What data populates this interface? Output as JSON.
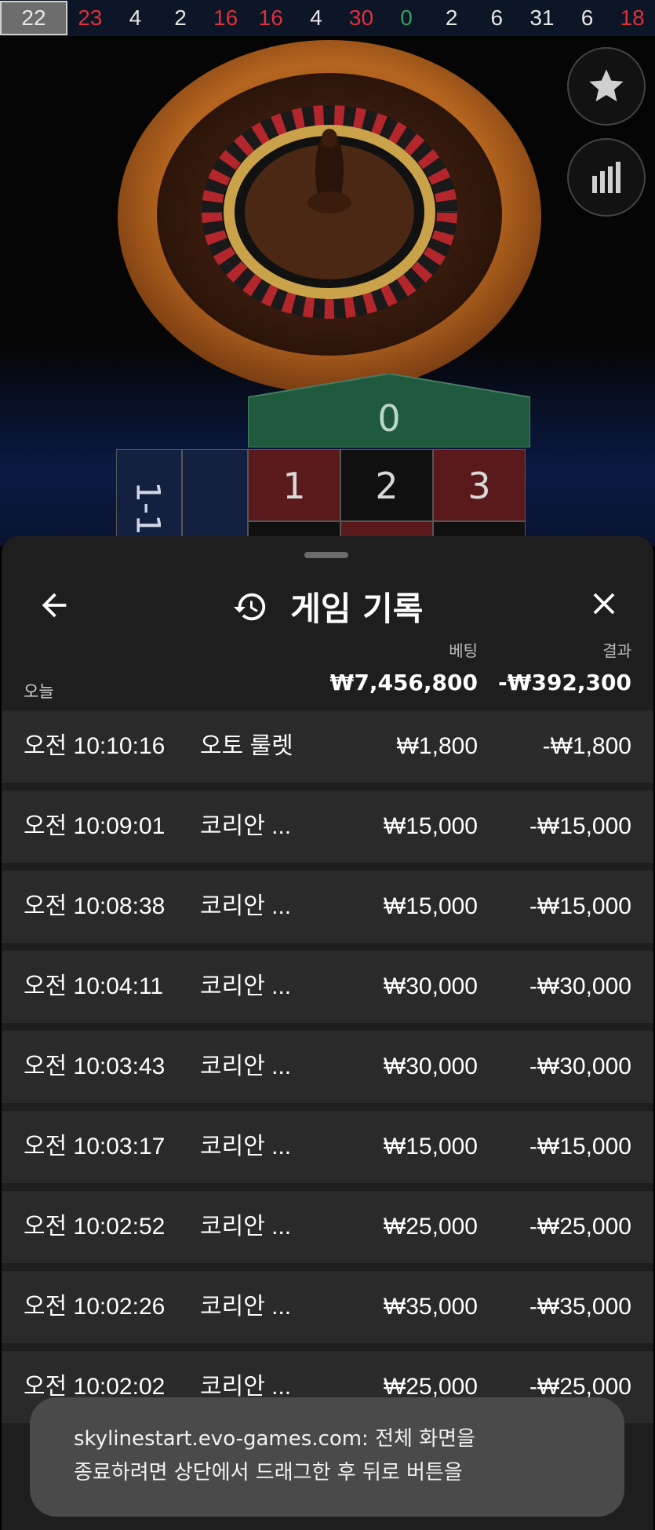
{
  "history_strip": [
    {
      "n": "22",
      "color": "current"
    },
    {
      "n": "23",
      "color": "red"
    },
    {
      "n": "4",
      "color": "black"
    },
    {
      "n": "2",
      "color": "black"
    },
    {
      "n": "16",
      "color": "red"
    },
    {
      "n": "16",
      "color": "red"
    },
    {
      "n": "4",
      "color": "black"
    },
    {
      "n": "30",
      "color": "red"
    },
    {
      "n": "0",
      "color": "green"
    },
    {
      "n": "2",
      "color": "black"
    },
    {
      "n": "6",
      "color": "black"
    },
    {
      "n": "31",
      "color": "black"
    },
    {
      "n": "6",
      "color": "black"
    },
    {
      "n": "18",
      "color": "red"
    }
  ],
  "table": {
    "zero": "0",
    "row1": [
      "1",
      "2",
      "3"
    ],
    "side_label": "1-1"
  },
  "sheet": {
    "title": "게임 기록",
    "col_bet": "베팅",
    "col_result": "결과",
    "today_label": "오늘",
    "total_bet": "₩7,456,800",
    "total_result": "-₩392,300",
    "rows": [
      {
        "time": "오전 10:10:16",
        "game": "오토 룰렛",
        "bet": "₩1,800",
        "result": "-₩1,800"
      },
      {
        "time": "오전 10:09:01",
        "game": "코리안 ...",
        "bet": "₩15,000",
        "result": "-₩15,000"
      },
      {
        "time": "오전 10:08:38",
        "game": "코리안 ...",
        "bet": "₩15,000",
        "result": "-₩15,000"
      },
      {
        "time": "오전 10:04:11",
        "game": "코리안 ...",
        "bet": "₩30,000",
        "result": "-₩30,000"
      },
      {
        "time": "오전 10:03:43",
        "game": "코리안 ...",
        "bet": "₩30,000",
        "result": "-₩30,000"
      },
      {
        "time": "오전 10:03:17",
        "game": "코리안 ...",
        "bet": "₩15,000",
        "result": "-₩15,000"
      },
      {
        "time": "오전 10:02:52",
        "game": "코리안 ...",
        "bet": "₩25,000",
        "result": "-₩25,000"
      },
      {
        "time": "오전 10:02:26",
        "game": "코리안 ...",
        "bet": "₩35,000",
        "result": "-₩35,000"
      },
      {
        "time": "오전 10:02:02",
        "game": "코리안 ...",
        "bet": "₩25,000",
        "result": "-₩25,000"
      }
    ]
  },
  "toast": {
    "line1": "skylinestart.evo-games.com: 전체 화면을",
    "line2": "종료하려면 상단에서 드래그한 후 뒤로 버튼을"
  },
  "colors": {
    "red": "#e0303a",
    "green": "#2ea35a",
    "felt_green": "#1f5a3e",
    "felt_red": "#5a1a1c",
    "sheet_bg": "#1e1e1e",
    "row_bg": "#2a2a2a"
  }
}
